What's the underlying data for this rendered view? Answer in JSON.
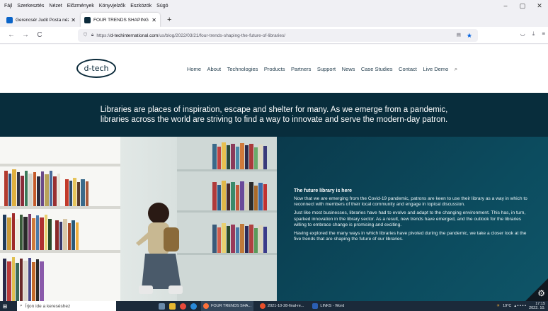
{
  "browser": {
    "menu": [
      "Fájl",
      "Szerkesztés",
      "Nézet",
      "Előzmények",
      "Könyvjelzők",
      "Eszközök",
      "Súgó"
    ],
    "window_controls": [
      "–",
      "▢",
      "✕"
    ],
    "tabs": [
      {
        "title": "Gerencsér Judit Posta nézete – ...",
        "active": false
      },
      {
        "title": "FOUR TRENDS SHAPING THE F...",
        "active": true
      }
    ],
    "new_tab": "+",
    "nav": {
      "back": "←",
      "forward": "→",
      "reload": "C"
    },
    "url_prefix": "https://",
    "url_domain": "d-techinternational.com",
    "url_path": "/us/blog/2022/03/21/four-trends-shaping-the-future-of-libraries/"
  },
  "site": {
    "logo": "d-tech",
    "nav": [
      "Home",
      "About",
      "Technologies",
      "Products",
      "Partners",
      "Support",
      "News",
      "Case Studies",
      "Contact",
      "Live Demo"
    ],
    "hero_text": "Libraries are places of inspiration, escape and shelter for many. As we emerge from a pandemic, libraries across the world are striving to find a way to innovate and serve the modern-day patron.",
    "panel": {
      "heading": "The future library is here",
      "paragraphs": [
        "Now that we are emerging from the Covid-19 pandemic, patrons are keen to use their library as a way in which to reconnect with members of their local community and engage in topical discussion.",
        "Just like most businesses, libraries have had to evolve and adapt to the changing environment. This has, in turn, sparked innovation in the library sector. As a result, new trends have emerged, and the outlook for the libraries willing to embrace change is promising and exciting.",
        "Having explored the many ways in which libraries have pivoted during the pandemic, we take a closer look at the five trends that are shaping the future of our libraries."
      ]
    }
  },
  "taskbar": {
    "search_placeholder": "Írjon ide a kereséshez",
    "apps": [
      {
        "label": "FOUR TRENDS SHA...",
        "active": true,
        "color": "#ff7139"
      },
      {
        "label": "2021-10-28-final-re...",
        "active": false,
        "color": "#e8502a"
      },
      {
        "label": "LINKS - Word",
        "active": false,
        "color": "#2b5fb4"
      }
    ],
    "weather": "19°C",
    "time": "17:15",
    "date": "2022. 10."
  }
}
